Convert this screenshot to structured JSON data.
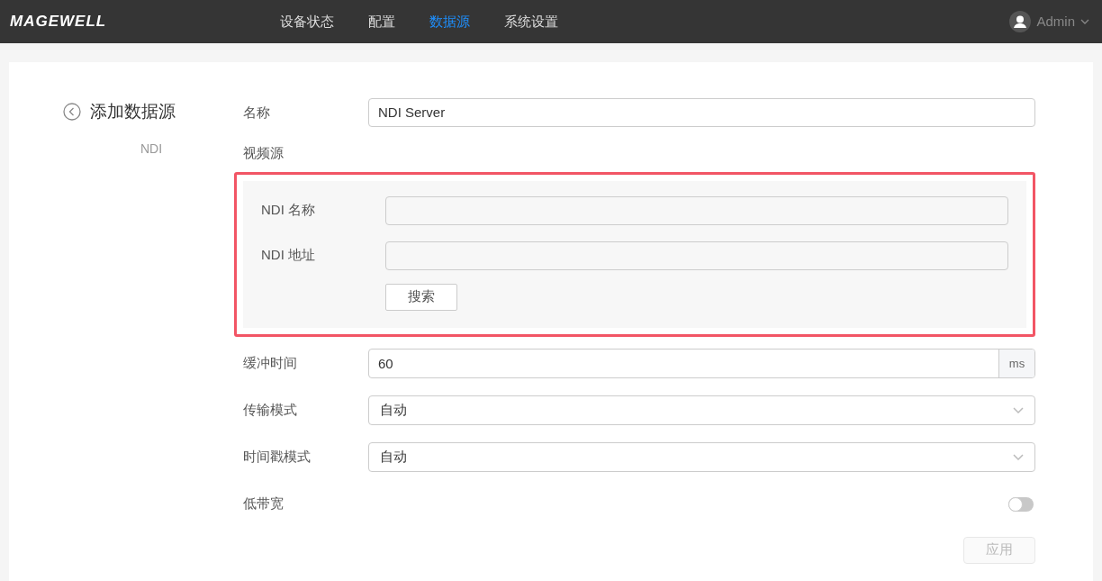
{
  "header": {
    "logo": "MAGEWELL",
    "nav": [
      {
        "label": "设备状态",
        "selected": false
      },
      {
        "label": "配置",
        "selected": false
      },
      {
        "label": "数据源",
        "selected": true
      },
      {
        "label": "系统设置",
        "selected": false
      }
    ],
    "user": "Admin"
  },
  "sidebar": {
    "title": "添加数据源",
    "subtitle": "NDI"
  },
  "form": {
    "name_label": "名称",
    "name_value": "NDI Server",
    "video_label": "视频源",
    "video_panel": {
      "fields": [
        {
          "label": "NDI 名称"
        },
        {
          "label": "NDI 地址"
        }
      ],
      "search_button": "搜索"
    },
    "rows": [
      {
        "kind": "unit",
        "label": "缓冲时间",
        "value": "60",
        "unit": "ms"
      },
      {
        "kind": "select",
        "label": "传输模式",
        "value": "自动"
      },
      {
        "kind": "select",
        "label": "时间戳模式",
        "value": "自动"
      },
      {
        "kind": "toggle",
        "label": "低带宽",
        "on": false
      }
    ],
    "apply_button": {
      "label": "应用",
      "disabled": true
    }
  }
}
